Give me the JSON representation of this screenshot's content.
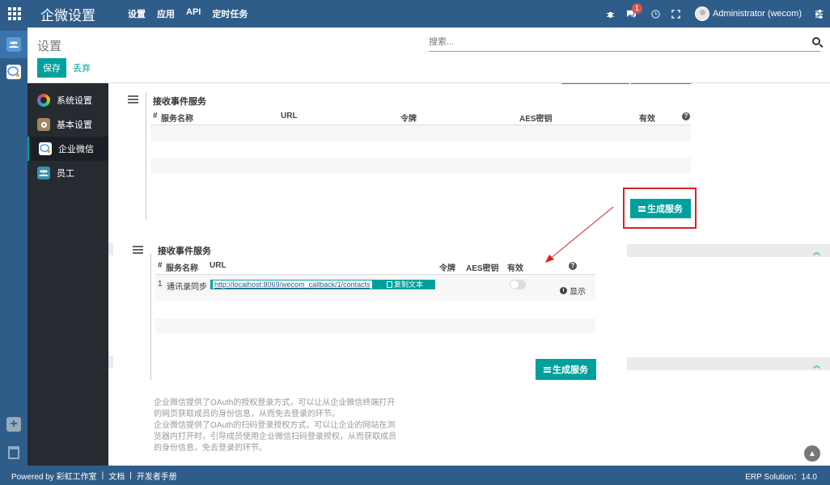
{
  "topbar": {
    "brand": "企微设置",
    "menu": [
      "设置",
      "应用",
      "API",
      "定时任务"
    ],
    "message_badge": "1",
    "user_name": "Administrator (wecom)"
  },
  "control_panel": {
    "title": "设置",
    "save_label": "保存",
    "discard_label": "丢弃",
    "search_placeholder": "搜索..."
  },
  "settings_sidebar": {
    "items": [
      {
        "label": "系统设置"
      },
      {
        "label": "基本设置"
      },
      {
        "label": "企业微信"
      },
      {
        "label": "员工"
      }
    ]
  },
  "section1": {
    "title": "接收事件服务",
    "columns": {
      "num": "#",
      "name": "服务名称",
      "url": "URL",
      "token": "令牌",
      "aes": "AES密钥",
      "active": "有效",
      "help": "?"
    },
    "generate_label": "生成服务"
  },
  "section2": {
    "title": "接收事件服务",
    "columns": {
      "num": "#",
      "name": "服务名称",
      "url": "URL",
      "token": "令牌",
      "aes": "AES密钥",
      "active": "有效",
      "help": "?"
    },
    "rows": [
      {
        "num": "1",
        "name": "通讯录同步",
        "url": "http://localhost:8069/wecom_callback/1/contacts",
        "copy_label": "复制文本",
        "show_label": "显示"
      }
    ],
    "generate_label": "生成服务"
  },
  "description": [
    "企业微信提供了OAuth的授权登录方式，可以让从企业微信终端打开的网页获取成员的身份信息，从而免去登录的环节。",
    "企业微信提供了OAuth的扫码登录授权方式，可以让企业的网站在浏览器内打开时，引导成员使用企业微信扫码登录授权，从而获取成员的身份信息，免去登录的环节。"
  ],
  "footer": {
    "powered": "Powered by 彩虹工作室",
    "docs": "文档",
    "dev_manual": "开发者手册",
    "version": "ERP Solution：14.0"
  }
}
